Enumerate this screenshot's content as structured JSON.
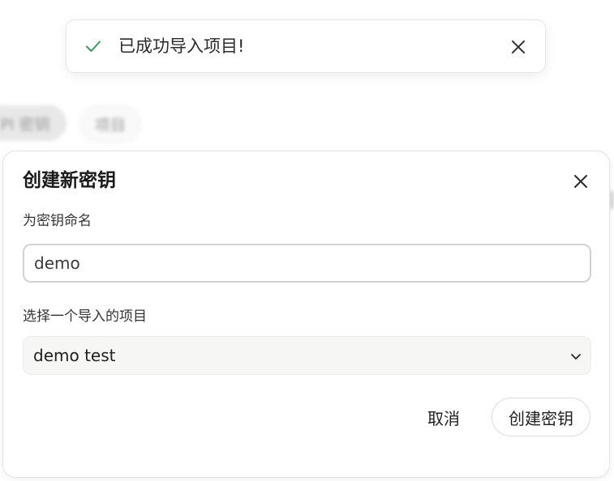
{
  "toast": {
    "message": "已成功导入项目!",
    "success_color": "#3a9a5b"
  },
  "background_tabs": {
    "active_label": "PI 密钥",
    "other_label": "项目"
  },
  "dialog": {
    "title": "创建新密钥",
    "name_label": "为密钥命名",
    "name_value": "demo",
    "project_label": "选择一个导入的项目",
    "project_value": "demo test",
    "cancel_label": "取消",
    "create_label": "创建密钥"
  }
}
